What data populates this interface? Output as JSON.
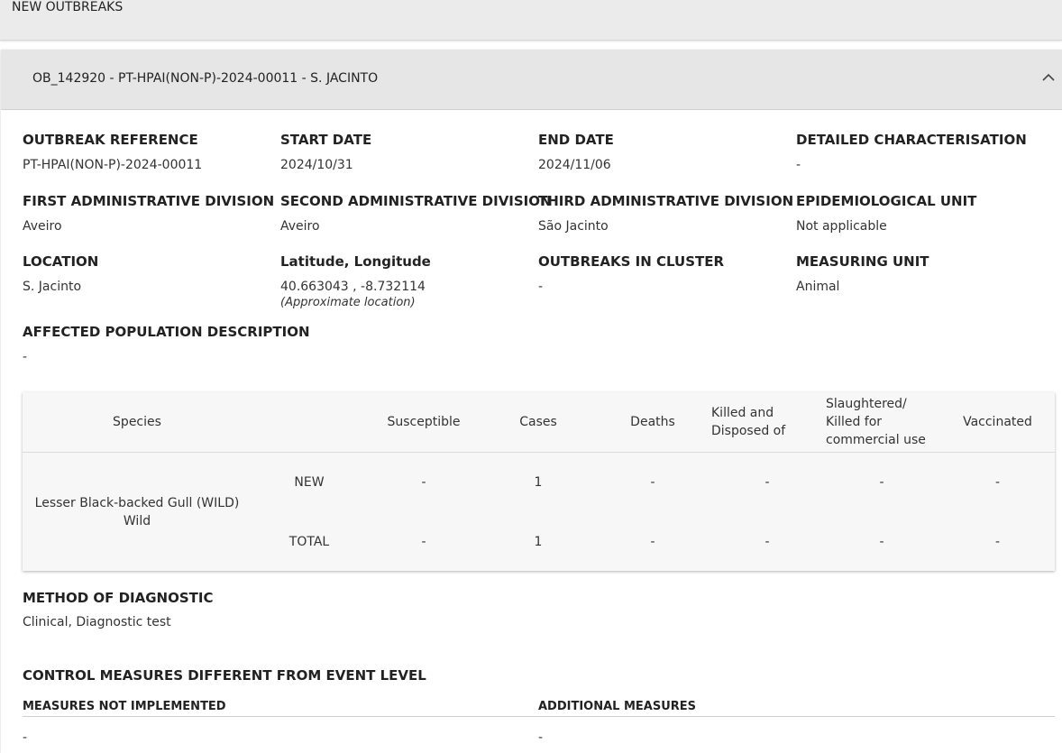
{
  "topbar": {
    "title": "NEW OUTBREAKS"
  },
  "outbreak": {
    "header_title": "OB_142920 - PT-HPAI(NON-P)-2024-00011 - S. JACINTO",
    "fields": {
      "reference": {
        "label": "OUTBREAK REFERENCE",
        "value": "PT-HPAI(NON-P)-2024-00011"
      },
      "start_date": {
        "label": "START DATE",
        "value": "2024/10/31"
      },
      "end_date": {
        "label": "END DATE",
        "value": "2024/11/06"
      },
      "characterisation": {
        "label": "DETAILED CHARACTERISATION",
        "value": "-"
      },
      "first_div": {
        "label": "FIRST ADMINISTRATIVE DIVISION",
        "value": "Aveiro"
      },
      "second_div": {
        "label": "SECOND ADMINISTRATIVE DIVISION",
        "value": "Aveiro"
      },
      "third_div": {
        "label": "THIRD ADMINISTRATIVE DIVISION",
        "value": "São Jacinto"
      },
      "epi_unit": {
        "label": "EPIDEMIOLOGICAL UNIT",
        "value": "Not applicable"
      },
      "location": {
        "label": "LOCATION",
        "value": "S. Jacinto"
      },
      "latlon": {
        "label": "Latitude, Longitude",
        "value": "40.663043 , -8.732114",
        "note": "(Approximate location)"
      },
      "cluster": {
        "label": "OUTBREAKS IN CLUSTER",
        "value": "-"
      },
      "measuring_unit": {
        "label": "MEASURING UNIT",
        "value": "Animal"
      },
      "affected": {
        "label": "AFFECTED POPULATION DESCRIPTION",
        "value": "-"
      }
    },
    "species_table": {
      "headers": {
        "species": "Species",
        "susceptible": "Susceptible",
        "cases": "Cases",
        "deaths": "Deaths",
        "killed": "Killed and Disposed of",
        "slaughtered": "Slaughtered/ Killed for commercial use",
        "vaccinated": "Vaccinated"
      },
      "species_name": "Lesser Black-backed Gull (WILD) Wild",
      "rows": [
        {
          "type": "NEW",
          "susceptible": "-",
          "cases": "1",
          "deaths": "-",
          "killed": "-",
          "slaughtered": "-",
          "vaccinated": "-"
        },
        {
          "type": "TOTAL",
          "susceptible": "-",
          "cases": "1",
          "deaths": "-",
          "killed": "-",
          "slaughtered": "-",
          "vaccinated": "-"
        }
      ]
    },
    "diagnostic": {
      "label": "METHOD OF DIAGNOSTIC",
      "value": "Clinical, Diagnostic test"
    },
    "control": {
      "label": "CONTROL MEASURES DIFFERENT FROM EVENT LEVEL",
      "not_implemented": {
        "label": "MEASURES NOT IMPLEMENTED",
        "value": "-"
      },
      "additional": {
        "label": "ADDITIONAL MEASURES",
        "value": "-"
      }
    }
  }
}
